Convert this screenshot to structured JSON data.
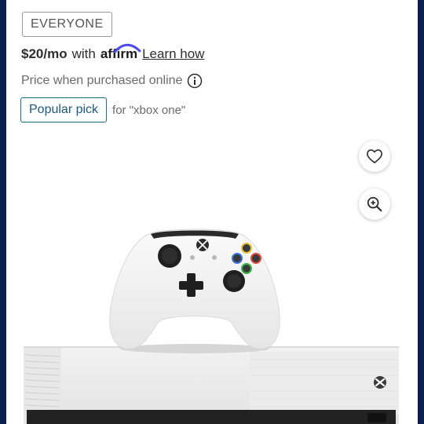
{
  "product": {
    "rating_badge": "EVERYONE",
    "financing": {
      "price": "$20/mo",
      "with": "with",
      "brand": "affirm",
      "link": "Learn how"
    },
    "price_note": "Price when purchased online",
    "popular_badge": "Popular pick",
    "popular_context": "for \"xbox one\""
  },
  "actions": {
    "favorite_icon": "heart-icon",
    "zoom_icon": "zoom-in-icon",
    "info_icon": "info-icon"
  },
  "colors": {
    "background_frame": "#0b1f4d",
    "popular_border": "#1d6a89",
    "badge_border": "#9a9a9a"
  }
}
